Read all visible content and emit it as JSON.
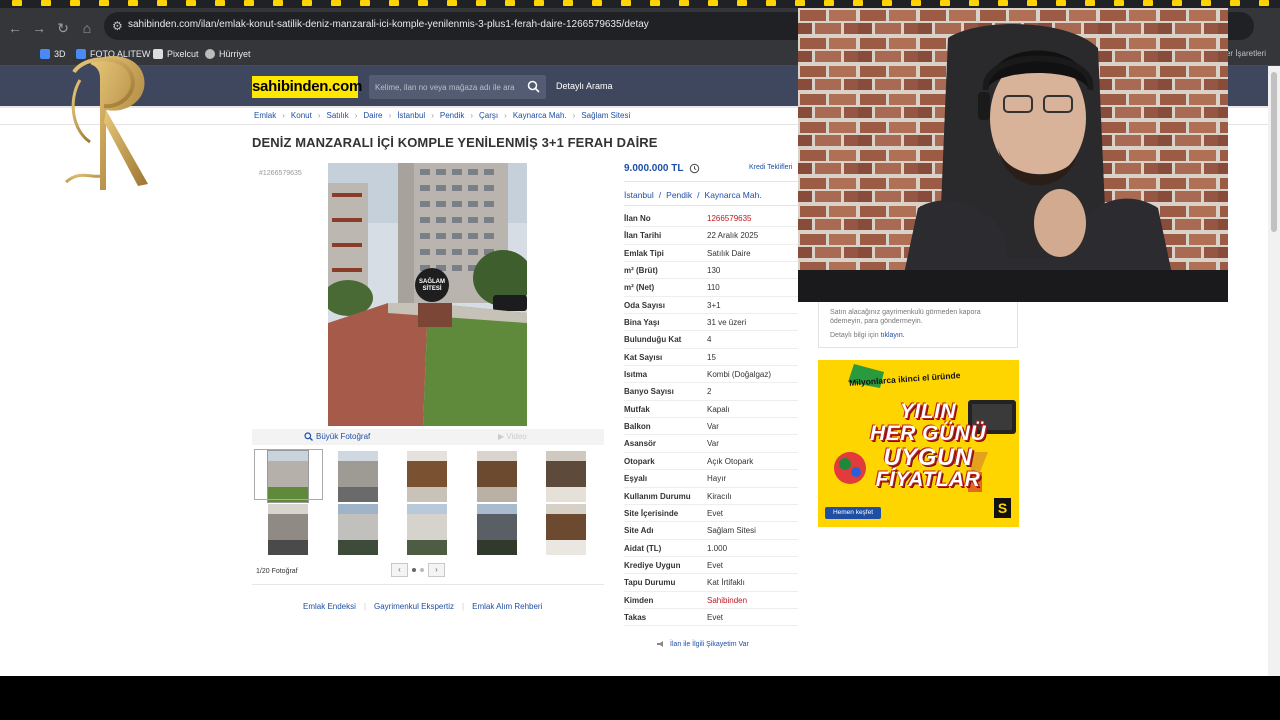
{
  "browser": {
    "url": "sahibinden.com/ilan/emlak-konut-satilik-deniz-manzarali-ici-komple-yenilenmis-3-plus1-ferah-daire-1266579635/detay",
    "bookmarks": [
      "3D",
      "FOTO ALITEW",
      "Pixelcut",
      "Hürriyet"
    ],
    "bookmarks_right": "Yer İşaretleri"
  },
  "site": {
    "logo": "sahibinden.com",
    "search_placeholder": "Kelime, ilan no veya mağaza adı ile ara",
    "detailed_search": "Detaylı Arama"
  },
  "breadcrumb": [
    "Emlak",
    "Konut",
    "Satılık",
    "Daire",
    "İstanbul",
    "Pendik",
    "Çarşı",
    "Kaynarca Mah.",
    "Sağlam Sitesi"
  ],
  "listing": {
    "title": "DENİZ MANZARALI İÇİ KOMPLE YENİLENMİŞ 3+1 FERAH DAİRE",
    "ad_no_small": "#1266579635",
    "photo_sign": "SAĞLAM SİTESİ",
    "big_photo_label": "Büyük Fotoğraf",
    "video_label": "Video",
    "photo_count": "1/20 Fotoğraf",
    "price": "9.000.000 TL",
    "credit_offers": "Kredi Teklifleri",
    "location": [
      "İstanbul",
      "Pendik",
      "Kaynarca Mah."
    ],
    "details": [
      {
        "k": "İlan No",
        "v": "1266579635",
        "red": true
      },
      {
        "k": "İlan Tarihi",
        "v": "22 Aralık 2025"
      },
      {
        "k": "Emlak Tipi",
        "v": "Satılık Daire"
      },
      {
        "k": "m² (Brüt)",
        "v": "130"
      },
      {
        "k": "m² (Net)",
        "v": "110"
      },
      {
        "k": "Oda Sayısı",
        "v": "3+1"
      },
      {
        "k": "Bina Yaşı",
        "v": "31 ve üzeri"
      },
      {
        "k": "Bulunduğu Kat",
        "v": "4"
      },
      {
        "k": "Kat Sayısı",
        "v": "15"
      },
      {
        "k": "Isıtma",
        "v": "Kombi (Doğalgaz)"
      },
      {
        "k": "Banyo Sayısı",
        "v": "2"
      },
      {
        "k": "Mutfak",
        "v": "Kapalı"
      },
      {
        "k": "Balkon",
        "v": "Var"
      },
      {
        "k": "Asansör",
        "v": "Var"
      },
      {
        "k": "Otopark",
        "v": "Açık Otopark"
      },
      {
        "k": "Eşyalı",
        "v": "Hayır"
      },
      {
        "k": "Kullanım Durumu",
        "v": "Kiracılı"
      },
      {
        "k": "Site İçerisinde",
        "v": "Evet"
      },
      {
        "k": "Site Adı",
        "v": "Sağlam Sitesi"
      },
      {
        "k": "Aidat (TL)",
        "v": "1.000"
      },
      {
        "k": "Krediye Uygun",
        "v": "Evet"
      },
      {
        "k": "Tapu Durumu",
        "v": "Kat İrtifaklı"
      },
      {
        "k": "Kimden",
        "v": "Sahibinden",
        "red": true
      },
      {
        "k": "Takas",
        "v": "Evet"
      }
    ],
    "complaint": "İlan ile İlgili Şikayetim Var"
  },
  "footer_links": [
    "Emlak Endeksi",
    "Gayrimenkul Ekspertiz",
    "Emlak Alım Rehberi"
  ],
  "sidebar": {
    "warning": "Satın alacağınız gayrimenkulü görmeden kapora ödemeyin, para göndermeyin.",
    "more_info_prefix": "Detaylı bilgi için",
    "more_info_link": "tıklayın.",
    "ad": {
      "top": "Milyonlarca ikinci el üründe",
      "line1": "YILIN",
      "line2": "HER GÜNÜ",
      "line3": "UYGUN",
      "line4": "FİYATLAR",
      "cta": "Hemen keşfet",
      "brand": "S"
    }
  },
  "colors": {
    "brand_yellow": "#ffe800",
    "link_blue": "#1e4fa5",
    "header_navy": "#3f475f",
    "accent_red": "#c4161c"
  }
}
